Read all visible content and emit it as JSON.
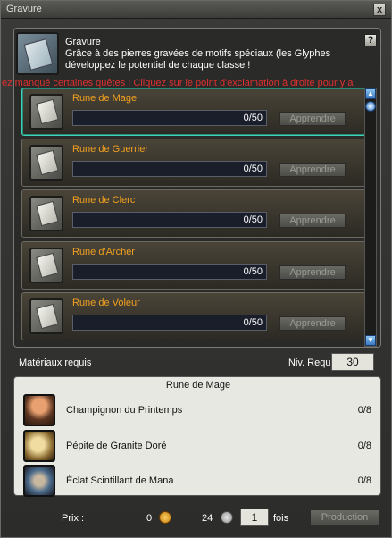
{
  "window": {
    "title": "Gravure",
    "close_label": "x"
  },
  "header": {
    "title": "Gravure",
    "description": "Grâce à des pierres gravées de motifs spéciaux (les Glyphes développez le potentiel de chaque classe !",
    "help_label": "?"
  },
  "warning": "ez manqué certaines quêtes ! Cliquez sur le point d'exclamation à droite pour y a",
  "runes": [
    {
      "name": "Rune de Mage",
      "progress": "0/50",
      "button": "Apprendre",
      "selected": true
    },
    {
      "name": "Rune de Guerrier",
      "progress": "0/50",
      "button": "Apprendre",
      "selected": false
    },
    {
      "name": "Rune de Clerc",
      "progress": "0/50",
      "button": "Apprendre",
      "selected": false
    },
    {
      "name": "Rune d'Archer",
      "progress": "0/50",
      "button": "Apprendre",
      "selected": false
    },
    {
      "name": "Rune de Voleur",
      "progress": "0/50",
      "button": "Apprendre",
      "selected": false
    }
  ],
  "requirements": {
    "materials_label": "Matériaux requis",
    "level_label": "Niv. Requis :",
    "level_value": "30"
  },
  "materials": {
    "title": "Rune de Mage",
    "items": [
      {
        "name": "Champignon du Printemps",
        "count": "0/8",
        "icon": "mushroom-icon"
      },
      {
        "name": "Pépite de Granite Doré",
        "count": "0/8",
        "icon": "granite-nugget-icon"
      },
      {
        "name": "Éclat Scintillant de Mana",
        "count": "0/8",
        "icon": "mana-shard-icon"
      }
    ]
  },
  "footer": {
    "price_label": "Prix :",
    "gold": "0",
    "silver": "24",
    "quantity": "1",
    "times_label": "fois",
    "production_label": "Production"
  },
  "colors": {
    "rune_name": "#f0a020",
    "warning": "#e03030",
    "selected_border": "#3fd4b8"
  }
}
